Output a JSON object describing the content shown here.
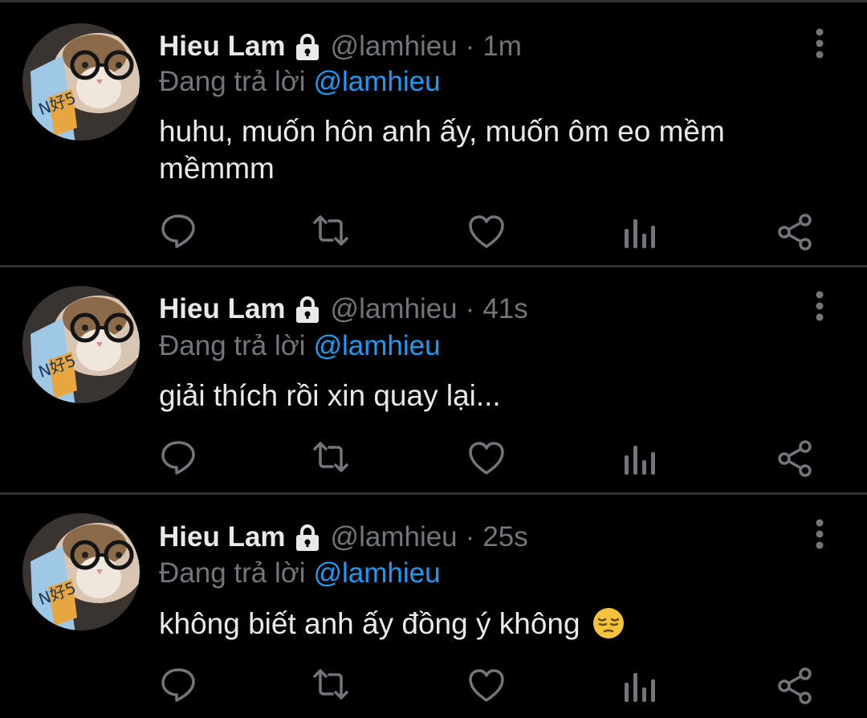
{
  "colors": {
    "background": "#000000",
    "divider": "#2f3336",
    "primary_text": "#e7e9ea",
    "secondary_text": "#71767b",
    "accent": "#1d9bf0"
  },
  "icons": {
    "lock": "lock-icon",
    "more": "more-vertical-icon",
    "reply": "reply-icon",
    "retweet": "retweet-icon",
    "like": "heart-icon",
    "analytics": "analytics-icon",
    "share": "share-icon"
  },
  "tweets": [
    {
      "display_name": "Hieu Lam",
      "handle": "@lamhieu",
      "separator": "·",
      "time": "1m",
      "reply_prefix": "Đang trả lời",
      "reply_to": "@lamhieu",
      "text": "huhu, muốn hôn anh ấy, muốn ôm eo mềm mềmmm"
    },
    {
      "display_name": "Hieu Lam",
      "handle": "@lamhieu",
      "separator": "·",
      "time": "41s",
      "reply_prefix": "Đang trả lời",
      "reply_to": "@lamhieu",
      "text": "giải thích rồi xin quay lại..."
    },
    {
      "display_name": "Hieu Lam",
      "handle": "@lamhieu",
      "separator": "·",
      "time": "25s",
      "reply_prefix": "Đang trả lời",
      "reply_to": "@lamhieu",
      "text": "không biết anh ấy đồng ý không",
      "emoji": "pensive-face-emoji"
    }
  ]
}
